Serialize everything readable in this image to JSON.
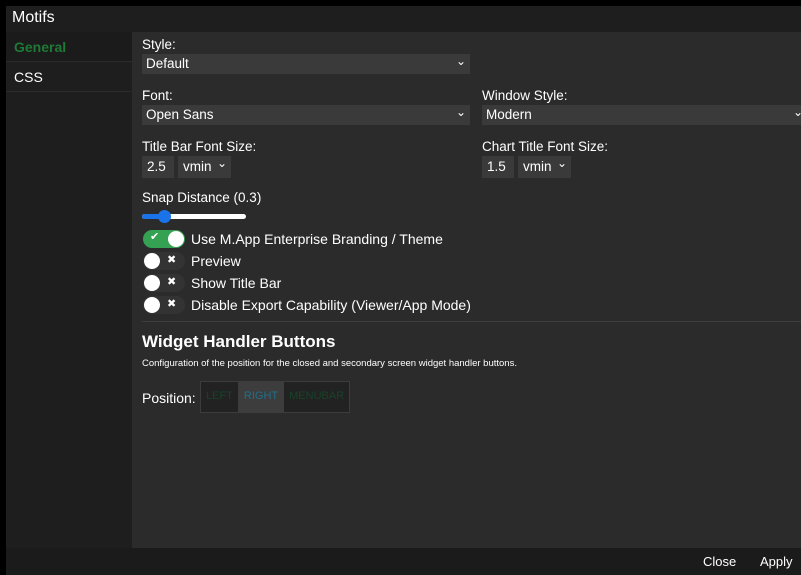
{
  "window": {
    "title": "Motifs"
  },
  "sidebar": {
    "items": [
      {
        "label": "General"
      },
      {
        "label": "CSS"
      }
    ]
  },
  "style": {
    "label": "Style:",
    "value": "Default"
  },
  "font": {
    "label": "Font:",
    "value": "Open Sans"
  },
  "window_style": {
    "label": "Window Style:",
    "value": "Modern"
  },
  "title_bar_font_size": {
    "label": "Title Bar Font Size:",
    "value": "2.5",
    "unit": "vmin"
  },
  "chart_title_font_size": {
    "label": "Chart Title Font Size:",
    "value": "1.5",
    "unit": "vmin"
  },
  "snap_distance": {
    "label": "Snap Distance (0.3)",
    "value": 0.3
  },
  "toggles": [
    {
      "label": "Use M.App Enterprise Branding / Theme",
      "on": true,
      "mark": "✔"
    },
    {
      "label": "Preview",
      "on": false,
      "mark": "✖"
    },
    {
      "label": "Show Title Bar",
      "on": false,
      "mark": "✖"
    },
    {
      "label": "Disable Export Capability (Viewer/App Mode)",
      "on": false,
      "mark": "✖"
    }
  ],
  "widget_handler": {
    "heading": "Widget Handler Buttons",
    "description": "Configuration of the position for the closed and secondary screen widget handler buttons.",
    "position_label": "Position:",
    "options": [
      {
        "label": "LEFT"
      },
      {
        "label": "RIGHT"
      },
      {
        "label": "MENUBAR"
      }
    ],
    "selected": "RIGHT"
  },
  "footer": {
    "close_label": "Close",
    "apply_label": "Apply"
  },
  "icons": {
    "chevron": "chevron-down-icon",
    "check": "check-icon",
    "cross": "x-icon"
  },
  "colors": {
    "accent_green": "#35a153",
    "slider_blue": "#1a73e8",
    "active_tab": "#1e7a35"
  }
}
